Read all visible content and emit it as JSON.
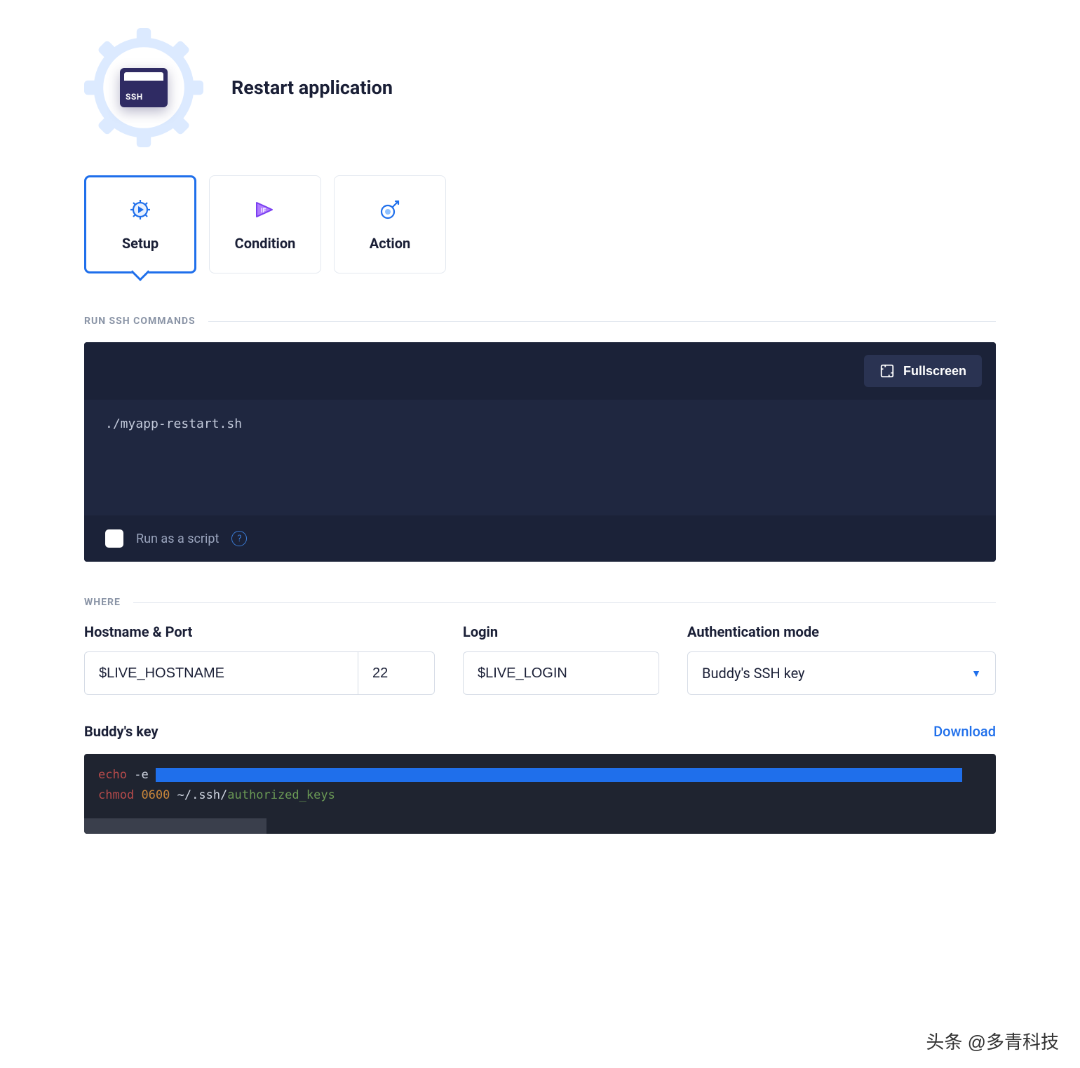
{
  "header": {
    "ssh_badge_text": "SSH",
    "title": "Restart application"
  },
  "tabs": [
    {
      "id": "setup",
      "label": "Setup",
      "active": true
    },
    {
      "id": "condition",
      "label": "Condition",
      "active": false
    },
    {
      "id": "action",
      "label": "Action",
      "active": false
    }
  ],
  "commands_section": {
    "label": "RUN SSH COMMANDS",
    "fullscreen_label": "Fullscreen",
    "code": "./myapp-restart.sh",
    "run_as_script_label": "Run as a script",
    "run_as_script_checked": false
  },
  "where_section": {
    "label": "WHERE",
    "hostname_label": "Hostname & Port",
    "hostname_value": "$LIVE_HOSTNAME",
    "port_value": "22",
    "login_label": "Login",
    "login_value": "$LIVE_LOGIN",
    "auth_label": "Authentication mode",
    "auth_value": "Buddy's SSH key"
  },
  "key_section": {
    "label": "Buddy's key",
    "download_label": "Download",
    "line1_cmd": "echo",
    "line1_flag": "-e",
    "line2_cmd": "chmod",
    "line2_mode": "0600",
    "line2_path_a": "~/.ssh/",
    "line2_path_b": "authorized_keys"
  },
  "watermark": "头条 @多青科技"
}
